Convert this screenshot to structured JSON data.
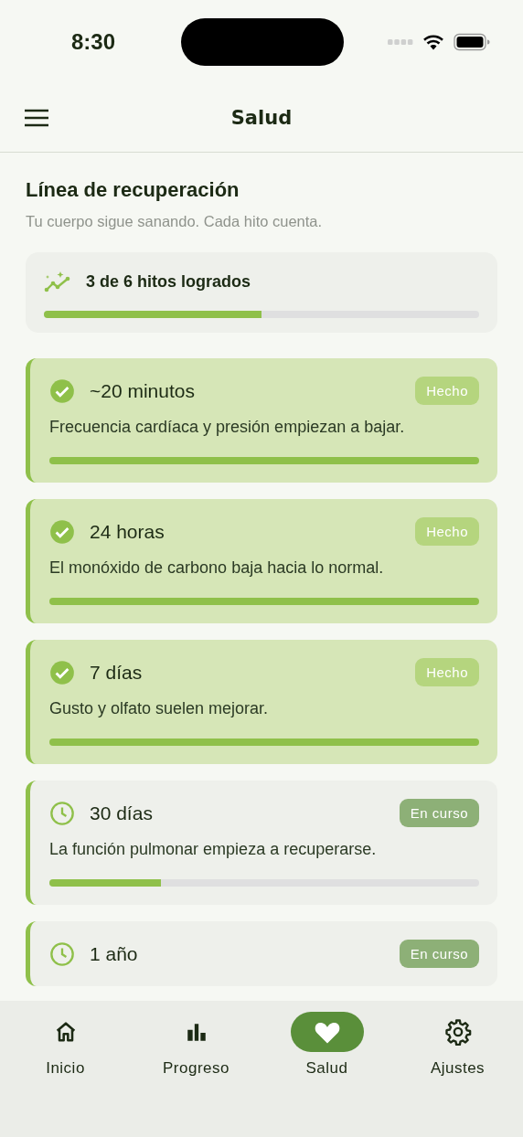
{
  "status_bar": {
    "time": "8:30"
  },
  "app_bar": {
    "title": "Salud"
  },
  "header": {
    "title": "Línea de recuperación",
    "subtitle": "Tu cuerpo sigue sanando. Cada hito cuenta."
  },
  "summary": {
    "label": "3 de 6 hitos logrados",
    "level": 0.5
  },
  "milestones": [
    {
      "kind": "done",
      "title": "~20 minutos",
      "badge": "Hecho",
      "description": "Frecuencia cardíaca y presión empiezan a bajar.",
      "level": 1
    },
    {
      "kind": "done",
      "title": "24 horas",
      "badge": "Hecho",
      "description": "El monóxido de carbono baja hacia lo normal.",
      "level": 1
    },
    {
      "kind": "done",
      "title": "7 días",
      "badge": "Hecho",
      "description": "Gusto y olfato suelen mejorar.",
      "level": 1
    },
    {
      "kind": "in_progress",
      "title": "30 días",
      "badge": "En curso",
      "description": "La función pulmonar empieza a recuperarse.",
      "level": 0.26
    },
    {
      "kind": "in_progress",
      "title": "1 año",
      "badge": "En curso"
    }
  ],
  "nav": [
    {
      "kind": "home",
      "label": "Inicio",
      "selected": false
    },
    {
      "kind": "chart",
      "label": "Progreso",
      "selected": false
    },
    {
      "kind": "heart",
      "label": "Salud",
      "selected": true
    },
    {
      "kind": "settings",
      "label": "Ajustes",
      "selected": false
    }
  ]
}
